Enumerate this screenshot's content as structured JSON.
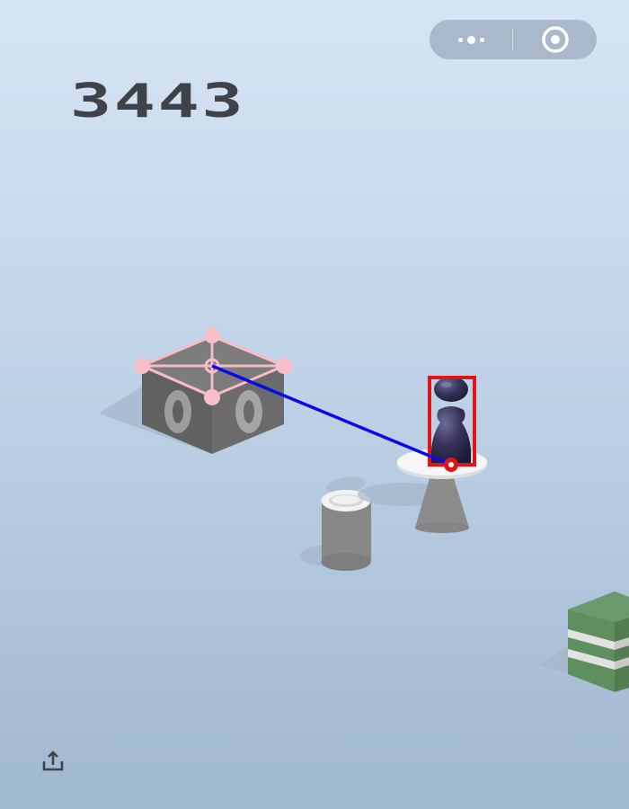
{
  "game": {
    "score": "3443"
  },
  "capsule": {
    "more_icon": "more-dots-icon",
    "close_icon": "target-close-icon"
  },
  "share": {
    "icon": "share-upload-icon"
  },
  "colors": {
    "sky_top": "#d6e5f5",
    "sky_bottom": "#9fb7cf",
    "score": "#3f4249",
    "overlay_pink": "#f6bcc6",
    "overlay_red": "#e01414",
    "overlay_blue": "#0a0ae6",
    "box_dark": "#646464",
    "stack_green": "#5f8e5f"
  }
}
